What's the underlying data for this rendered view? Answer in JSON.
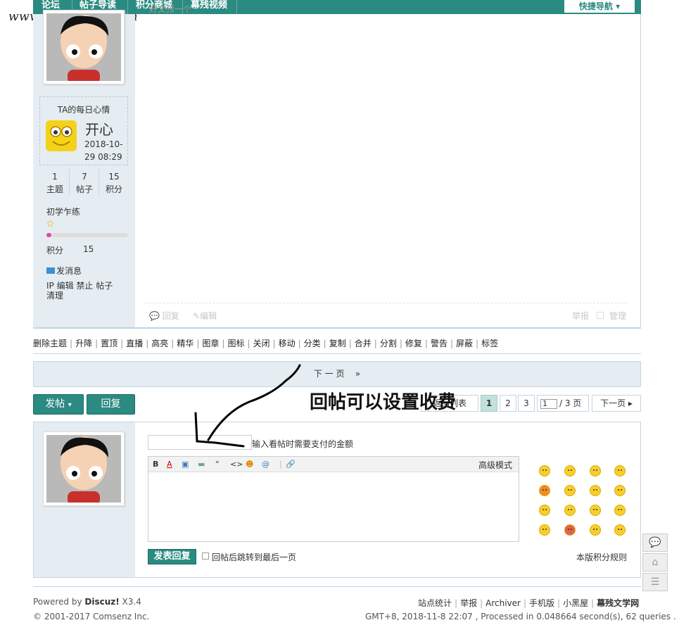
{
  "watermark": "www.mucanzhe.com",
  "nav": {
    "items": [
      "论坛",
      "帖子导读",
      "积分商城",
      "幕残视频"
    ],
    "quick_nav": "快捷导航 ▾"
  },
  "post1": {
    "text_fragment": "好文顶一个",
    "mood": {
      "title": "TA的每日心情",
      "word": "开心",
      "date": "2018-10-29 08:29"
    },
    "stats": [
      {
        "value": "1",
        "label": "主题"
      },
      {
        "value": "7",
        "label": "帖子"
      },
      {
        "value": "15",
        "label": "积分"
      }
    ],
    "rank": "初学乍练",
    "rank_progress": 0.06,
    "points_label": "积分",
    "points_value": "15",
    "send_message": "发消息",
    "admin_links": "IP 编辑 禁止 帖子 清理",
    "reply": "回复",
    "edit": "编辑",
    "report": "举报",
    "manage": "管理"
  },
  "mod_actions": [
    "删除主题",
    "升降",
    "置顶",
    "直播",
    "高亮",
    "精华",
    "图章",
    "图标",
    "关闭",
    "移动",
    "分类",
    "复制",
    "合并",
    "分割",
    "修复",
    "警告",
    "屏蔽",
    "标签"
  ],
  "next_page_bar": "下 一 页    »",
  "buttons": {
    "post": "发帖",
    "post_arrow": "▾",
    "reply": "回复"
  },
  "pagination": {
    "back": "返回列表",
    "pages": [
      "1",
      "2",
      "3"
    ],
    "jump_value": "1",
    "total": "/ 3 页",
    "next": "下一页 ▸"
  },
  "annotation": "回帖可以设置收费",
  "reply_form": {
    "price_hint": "输入看帖时需要支付的金额",
    "toolbar": [
      "B",
      "A",
      "▣",
      "▬",
      "“",
      "<>",
      "☻",
      "@",
      "|",
      "🔗"
    ],
    "advanced_mode": "高级模式",
    "submit": "发表回复",
    "jump_label": "回帖后跳转到最后一页",
    "rules": "本版积分规则"
  },
  "footer": {
    "powered_prefix": "Powered by ",
    "product": "Discuz!",
    "version": " X3.4",
    "copyright": "© 2001-2017 Comsenz Inc.",
    "links": [
      "站点统计",
      "举报",
      "Archiver",
      "手机版",
      "小黑屋",
      "幕残文学网"
    ],
    "gmt": "GMT+8, 2018-11-8 22:07 , Processed in 0.048664 second(s), 62 queries ."
  },
  "side_float": [
    "💬",
    "⌂",
    "☰"
  ],
  "colors": {
    "brand_teal": "#2b8a81",
    "panel_bg": "#e5edf2",
    "border": "#c2d5e3"
  }
}
